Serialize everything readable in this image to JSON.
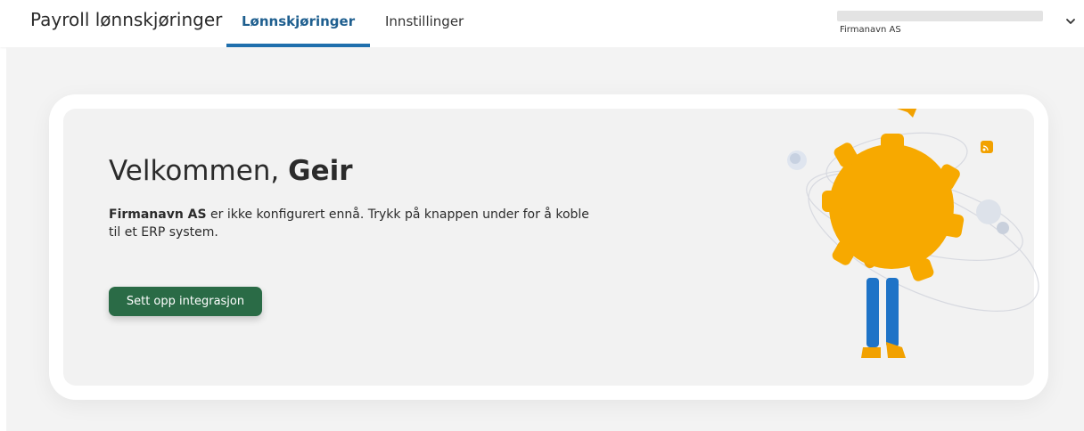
{
  "header": {
    "app_title": "Payroll lønnskjøringer",
    "tabs": [
      {
        "label": "Lønnskjøringer",
        "active": true
      },
      {
        "label": "Innstillinger",
        "active": false
      }
    ],
    "company_name": "Firmanavn AS",
    "accent_color": "#1f6fad"
  },
  "main": {
    "greeting_prefix": "Velkommen, ",
    "user_name": "Geir",
    "company_name": "Firmanavn AS",
    "description_rest": " er ikke konfigurert ennå. Trykk på knappen under for å koble til et ERP system.",
    "setup_button_label": "Sett opp integrasjon",
    "button_color": "#2a6b46",
    "illustration_icons": [
      "paper-plane-icon",
      "gear-icon",
      "rss-icon",
      "person-icon"
    ]
  }
}
